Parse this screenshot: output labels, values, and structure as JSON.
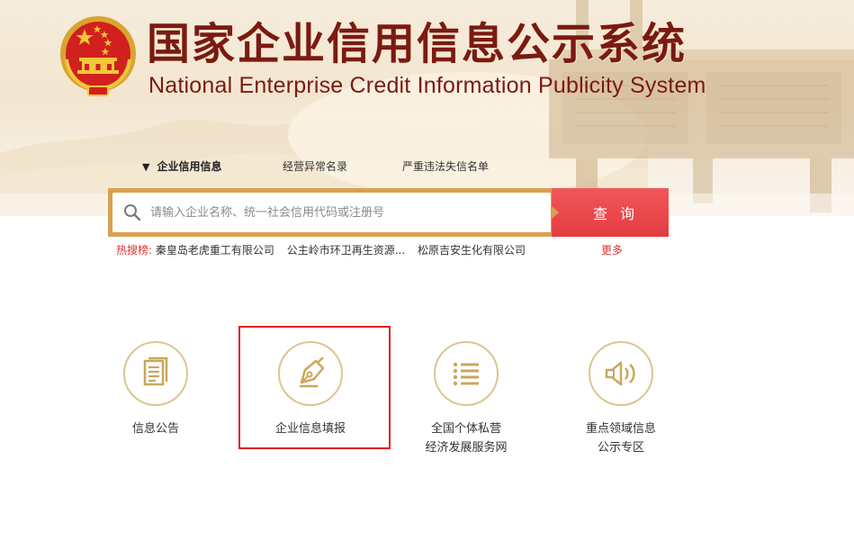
{
  "header": {
    "title_cn": "国家企业信用信息公示系统",
    "title_en": "National Enterprise Credit Information Publicity System"
  },
  "nav": {
    "tabs": [
      {
        "label": "企业信用信息",
        "active": true
      },
      {
        "label": "经营异常名录",
        "active": false
      },
      {
        "label": "严重违法失信名单",
        "active": false
      }
    ]
  },
  "search": {
    "placeholder": "请输入企业名称、统一社会信用代码或注册号",
    "value": "",
    "button_label": "查询"
  },
  "hot": {
    "label": "热搜榜:",
    "items": [
      "秦皇岛老虎重工有限公司",
      "公主岭市环卫再生资源...",
      "松原吉安生化有限公司"
    ],
    "more_label": "更多"
  },
  "services": [
    {
      "label": "信息公告",
      "icon": "document-icon"
    },
    {
      "label": "企业信息填报",
      "icon": "pen-nib-icon"
    },
    {
      "label": "全国个体私营经济发展服务网",
      "line1": "全国个体私营",
      "line2": "经济发展服务网",
      "icon": "list-icon"
    },
    {
      "label": "重点领域信息公示专区",
      "line1": "重点领域信息",
      "line2": "公示专区",
      "icon": "speaker-icon"
    }
  ],
  "colors": {
    "title": "#7a1a12",
    "accent_gold": "#d9a14e",
    "button_red": "#e8474a",
    "hot_red": "#e0312f",
    "icon_gold": "#c9a75e",
    "highlight": "#e02020"
  }
}
